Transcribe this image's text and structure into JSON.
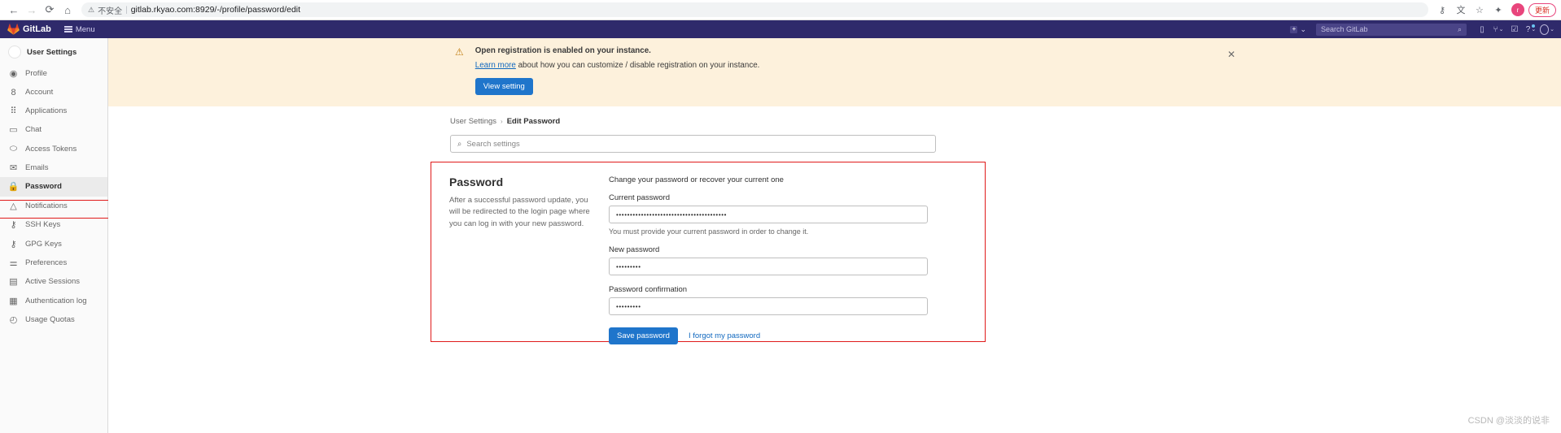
{
  "browser": {
    "back_icon": "←",
    "forward_icon": "→",
    "reload_icon": "⟳",
    "home_icon": "⌂",
    "warning_icon": "⚠",
    "insecure_label": "不安全",
    "separator": "|",
    "url": "gitlab.rkyao.com:8929/-/profile/password/edit",
    "key_icon": "⚷",
    "translate_icon": "文",
    "bookmark_icon": "☆",
    "extensions_icon": "✦",
    "profile_initial": "r",
    "update_label": "更新"
  },
  "navbar": {
    "brand": "GitLab",
    "menu_label": "Menu",
    "create_icon": "+",
    "create_chevron": "⌄",
    "search_placeholder": "Search GitLab",
    "search_icon": "⌕",
    "issues_icon": "▯",
    "merge_icon": "⑂",
    "merge_chevron": "⌄",
    "todos_icon": "☑",
    "help_icon": "?",
    "help_chevron": "⌄",
    "user_chevron": "⌄"
  },
  "sidebar": {
    "title": "User Settings",
    "items": [
      {
        "label": "Profile",
        "icon": "◉",
        "active": false
      },
      {
        "label": "Account",
        "icon": "8",
        "active": false
      },
      {
        "label": "Applications",
        "icon": "⠿",
        "active": false
      },
      {
        "label": "Chat",
        "icon": "▭",
        "active": false
      },
      {
        "label": "Access Tokens",
        "icon": "⬭",
        "active": false
      },
      {
        "label": "Emails",
        "icon": "✉",
        "active": false
      },
      {
        "label": "Password",
        "icon": "🔒",
        "active": true
      },
      {
        "label": "Notifications",
        "icon": "△",
        "active": false
      },
      {
        "label": "SSH Keys",
        "icon": "⚷",
        "active": false
      },
      {
        "label": "GPG Keys",
        "icon": "⚷",
        "active": false
      },
      {
        "label": "Preferences",
        "icon": "⚌",
        "active": false
      },
      {
        "label": "Active Sessions",
        "icon": "▤",
        "active": false
      },
      {
        "label": "Authentication log",
        "icon": "▦",
        "active": false
      },
      {
        "label": "Usage Quotas",
        "icon": "◴",
        "active": false
      }
    ]
  },
  "banner": {
    "warning_icon": "⚠",
    "headline": "Open registration is enabled on your instance.",
    "link_text": "Learn more",
    "body_rest": " about how you can customize / disable registration on your instance.",
    "button_label": "View setting",
    "close_icon": "✕"
  },
  "breadcrumb": {
    "parent": "User Settings",
    "separator": "›",
    "current": "Edit Password"
  },
  "search_settings": {
    "icon": "⌕",
    "placeholder": "Search settings"
  },
  "password_section": {
    "title": "Password",
    "description": "After a successful password update, you will be redirected to the login page where you can log in with your new password.",
    "lead": "Change your password or recover your current one",
    "current_password": {
      "label": "Current password",
      "value": "••••••••••••••••••••••••••••••••••••••••",
      "hint": "You must provide your current password in order to change it."
    },
    "new_password": {
      "label": "New password",
      "value": "•••••••••"
    },
    "password_confirmation": {
      "label": "Password confirmation",
      "value": "•••••••••"
    },
    "save_label": "Save password",
    "forgot_label": "I forgot my password"
  },
  "watermark": "CSDN @淡淡的说非",
  "colors": {
    "gitlab_navy": "#2f2a6b",
    "accent_blue": "#1f75cb",
    "link_blue": "#1068bf",
    "banner_bg": "#fdf1dc",
    "annotation_red": "#e01b1b"
  }
}
